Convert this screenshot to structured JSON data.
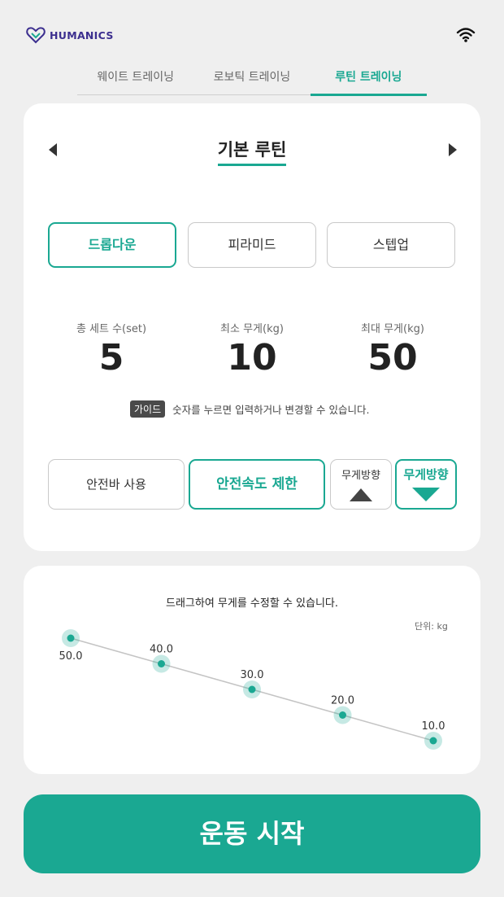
{
  "header": {
    "brand": "HUMANICS",
    "logo_icon": "heart-link-logo",
    "wifi_icon": "wifi-icon"
  },
  "tabs": [
    {
      "label": "웨이트 트레이닝",
      "active": false
    },
    {
      "label": "로보틱 트레이닝",
      "active": false
    },
    {
      "label": "루틴 트레이닝",
      "active": true
    }
  ],
  "routine": {
    "title": "기본 루틴",
    "modes": [
      {
        "label": "드롭다운",
        "active": true
      },
      {
        "label": "피라미드",
        "active": false
      },
      {
        "label": "스텝업",
        "active": false
      }
    ],
    "stats": [
      {
        "label": "총 세트 수(set)",
        "value": "5"
      },
      {
        "label": "최소 무게(kg)",
        "value": "10"
      },
      {
        "label": "최대 무게(kg)",
        "value": "50"
      }
    ],
    "guide_badge": "가이드",
    "guide_text": "숫자를 누르면 입력하거나 변경할 수 있습니다.",
    "options": {
      "safety_bar": "안전바 사용",
      "speed_limit": "안전속도 제한",
      "weight_dir_up": "무게방향",
      "weight_dir_down": "무게방향"
    }
  },
  "chart_hint": "드래그하여 무게를 수정할 수 있습니다.",
  "unit_label": "단위: kg",
  "chart_data": {
    "type": "line",
    "x": [
      1,
      2,
      3,
      4,
      5
    ],
    "values": [
      50.0,
      40.0,
      30.0,
      20.0,
      10.0
    ],
    "labels": [
      "50.0",
      "40.0",
      "30.0",
      "20.0",
      "10.0"
    ],
    "ylim": [
      10,
      50
    ],
    "color": "#1aa892"
  },
  "start_button": "운동 시작",
  "colors": {
    "accent": "#1aa892",
    "background": "#efefef"
  }
}
